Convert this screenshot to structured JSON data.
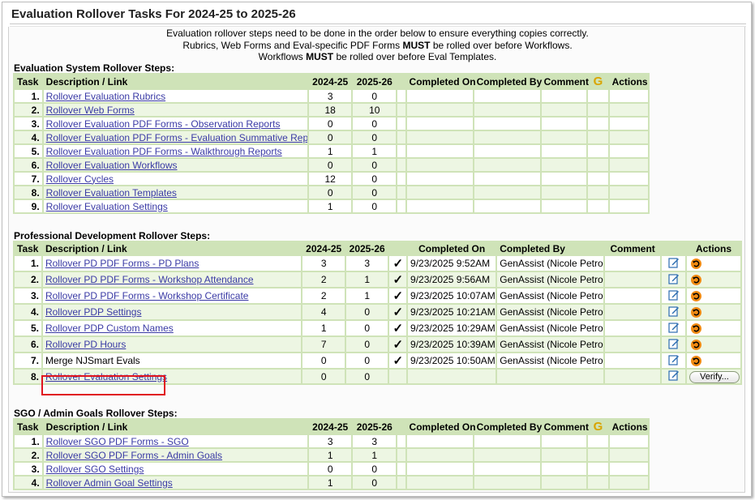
{
  "page": {
    "title": "Evaluation Rollover Tasks For 2024-25 to 2025-26",
    "intro": [
      {
        "pre": "Evaluation rollover steps need to be done in the order below to ensure everything copies correctly.",
        "bold": "",
        "post": ""
      },
      {
        "pre": "Rubrics, Web Forms and Eval-specific PDF Forms ",
        "bold": "MUST",
        "post": " be rolled over before Workflows."
      },
      {
        "pre": "Workflows ",
        "bold": "MUST",
        "post": " be rolled over before Eval Templates."
      }
    ]
  },
  "headers": {
    "task": "Task",
    "desc": "Description / Link",
    "y1": "2024-25",
    "y2": "2025-26",
    "completed_on": "Completed On",
    "completed_by": "Completed By",
    "comment": "Comment",
    "actions": "Actions",
    "g": "G"
  },
  "sections": [
    {
      "title": "Evaluation System Rollover Steps:",
      "rows": [
        {
          "task": "1.",
          "desc": "Rollover Evaluation Rubrics",
          "link": true,
          "y1": "3",
          "y2": "0"
        },
        {
          "task": "2.",
          "desc": "Rollover Web Forms",
          "link": true,
          "y1": "18",
          "y2": "10"
        },
        {
          "task": "3.",
          "desc": "Rollover Evaluation PDF Forms - Observation Reports",
          "link": true,
          "y1": "0",
          "y2": "0"
        },
        {
          "task": "4.",
          "desc": "Rollover Evaluation PDF Forms - Evaluation Summative Reports",
          "link": true,
          "y1": "0",
          "y2": "0"
        },
        {
          "task": "5.",
          "desc": "Rollover Evaluation PDF Forms - Walkthrough Reports",
          "link": true,
          "y1": "1",
          "y2": "1"
        },
        {
          "task": "6.",
          "desc": "Rollover Evaluation Workflows",
          "link": true,
          "y1": "0",
          "y2": "0"
        },
        {
          "task": "7.",
          "desc": "Rollover Cycles",
          "link": true,
          "y1": "12",
          "y2": "0"
        },
        {
          "task": "8.",
          "desc": "Rollover Evaluation Templates",
          "link": true,
          "y1": "0",
          "y2": "0"
        },
        {
          "task": "9.",
          "desc": "Rollover Evaluation Settings",
          "link": true,
          "y1": "1",
          "y2": "0"
        }
      ]
    },
    {
      "title": "Professional Development Rollover Steps:",
      "verify_label": "Verify...",
      "rows": [
        {
          "task": "1.",
          "desc": "Rollover PD PDF Forms - PD Plans",
          "link": true,
          "y1": "3",
          "y2": "3",
          "done": true,
          "on": "9/23/2025 9:52AM",
          "by": "GenAssist (Nicole Petron)"
        },
        {
          "task": "2.",
          "desc": "Rollover PD PDF Forms - Workshop Attendance",
          "link": true,
          "y1": "2",
          "y2": "1",
          "done": true,
          "on": "9/23/2025 9:56AM",
          "by": "GenAssist (Nicole Petron)"
        },
        {
          "task": "3.",
          "desc": "Rollover PD PDF Forms - Workshop Certificate",
          "link": true,
          "y1": "2",
          "y2": "1",
          "done": true,
          "on": "9/23/2025 10:07AM",
          "by": "GenAssist (Nicole Petron)"
        },
        {
          "task": "4.",
          "desc": "Rollover PDP Settings",
          "link": true,
          "y1": "4",
          "y2": "0",
          "done": true,
          "on": "9/23/2025 10:21AM",
          "by": "GenAssist (Nicole Petron)"
        },
        {
          "task": "5.",
          "desc": "Rollover PDP Custom Names",
          "link": true,
          "y1": "1",
          "y2": "0",
          "done": true,
          "on": "9/23/2025 10:29AM",
          "by": "GenAssist (Nicole Petron)"
        },
        {
          "task": "6.",
          "desc": "Rollover PD Hours",
          "link": true,
          "y1": "7",
          "y2": "0",
          "done": true,
          "on": "9/23/2025 10:39AM",
          "by": "GenAssist (Nicole Petron)"
        },
        {
          "task": "7.",
          "desc": "Merge NJSmart Evals",
          "link": false,
          "y1": "0",
          "y2": "0",
          "done": true,
          "on": "9/23/2025 10:50AM",
          "by": "GenAssist (Nicole Petron)"
        },
        {
          "task": "8.",
          "desc": "Rollover Evaluation Settings",
          "link": true,
          "y1": "0",
          "y2": "0",
          "done": false,
          "on": "",
          "by": "",
          "verify": true
        }
      ]
    },
    {
      "title": "SGO / Admin Goals Rollover Steps:",
      "rows": [
        {
          "task": "1.",
          "desc": "Rollover SGO PDF Forms - SGO",
          "link": true,
          "y1": "3",
          "y2": "3"
        },
        {
          "task": "2.",
          "desc": "Rollover SGO PDF Forms - Admin Goals",
          "link": true,
          "y1": "1",
          "y2": "1"
        },
        {
          "task": "3.",
          "desc": "Rollover SGO Settings",
          "link": true,
          "y1": "0",
          "y2": "0"
        },
        {
          "task": "4.",
          "desc": "Rollover Admin Goal Settings",
          "link": true,
          "y1": "1",
          "y2": "0"
        }
      ]
    }
  ],
  "colors": {
    "header_bg": "#cfe3b8",
    "link": "#3a3aa5",
    "highlight_box": "#e0141e",
    "undo_icon": "#f08a12"
  }
}
